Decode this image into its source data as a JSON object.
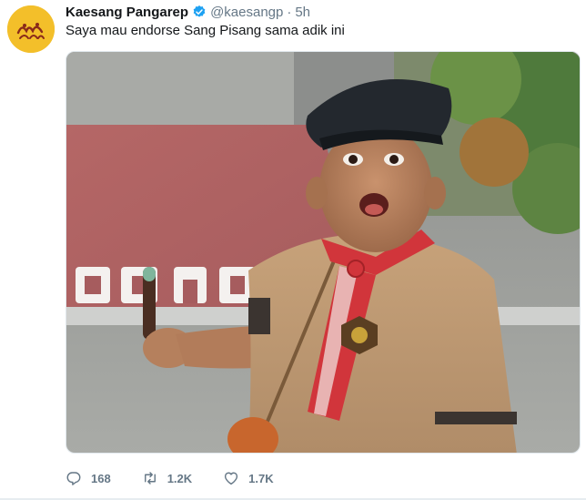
{
  "tweet": {
    "author_name": "Kaesang Pangarep",
    "handle": "@kaesangp",
    "separator": "·",
    "time": "5h",
    "text": "Saya mau endorse Sang Pisang sama adik ini",
    "verified": true
  },
  "actions": {
    "replies": "168",
    "retweets": "1.2K",
    "likes": "1.7K"
  },
  "colors": {
    "avatar_bg": "#f3bf2a",
    "verified": "#1da1f2",
    "secondary_text": "#657786"
  },
  "icons": {
    "reply": "reply-icon",
    "retweet": "retweet-icon",
    "like": "heart-icon",
    "verified": "verified-badge-icon"
  }
}
